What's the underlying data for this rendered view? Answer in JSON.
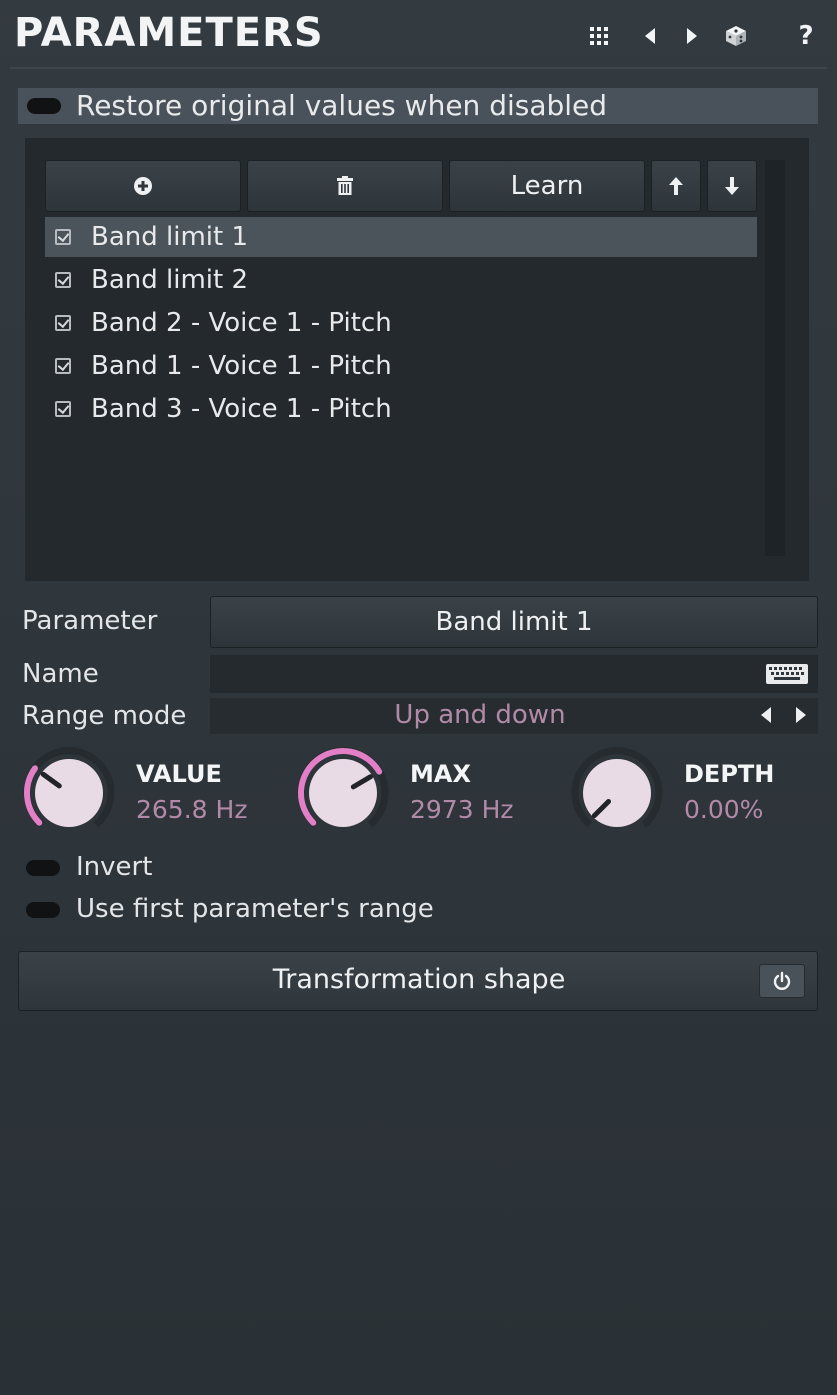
{
  "header": {
    "title": "PARAMETERS",
    "icons": [
      "grid-icon",
      "prev-icon",
      "next-icon",
      "dice-icon",
      "help-icon"
    ],
    "help_glyph": "?"
  },
  "restore": {
    "label": "Restore original values when disabled",
    "enabled": false
  },
  "toolbar": {
    "add_icon": "plus-circle-icon",
    "delete_icon": "trash-icon",
    "learn_label": "Learn",
    "up_icon": "arrow-up-icon",
    "down_icon": "arrow-down-icon"
  },
  "list": {
    "items": [
      {
        "label": "Band limit 1",
        "checked": true,
        "selected": true
      },
      {
        "label": "Band limit 2",
        "checked": true,
        "selected": false
      },
      {
        "label": "Band 2 - Voice 1 - Pitch",
        "checked": true,
        "selected": false
      },
      {
        "label": "Band 1 - Voice 1 - Pitch",
        "checked": true,
        "selected": false
      },
      {
        "label": "Band 3 - Voice 1 - Pitch",
        "checked": true,
        "selected": false
      }
    ]
  },
  "parameter": {
    "label": "Parameter",
    "value": "Band limit 1"
  },
  "name": {
    "label": "Name",
    "value": ""
  },
  "range_mode": {
    "label": "Range mode",
    "value": "Up and down"
  },
  "knobs": [
    {
      "title": "VALUE",
      "value": "265.8 Hz",
      "level": 0.3
    },
    {
      "title": "MAX",
      "value": "2973 Hz",
      "level": 0.72
    },
    {
      "title": "DEPTH",
      "value": "0.00%",
      "level": 0.0
    }
  ],
  "toggles": {
    "invert": {
      "label": "Invert",
      "enabled": false
    },
    "first_range": {
      "label": "Use first parameter's range",
      "enabled": false
    }
  },
  "shape": {
    "label": "Transformation shape",
    "power_icon": "power-icon"
  },
  "colors": {
    "accent": "#e27fc6",
    "value_text": "#b28aa8",
    "panel": "#23292d",
    "selected_row": "#4b545b"
  }
}
